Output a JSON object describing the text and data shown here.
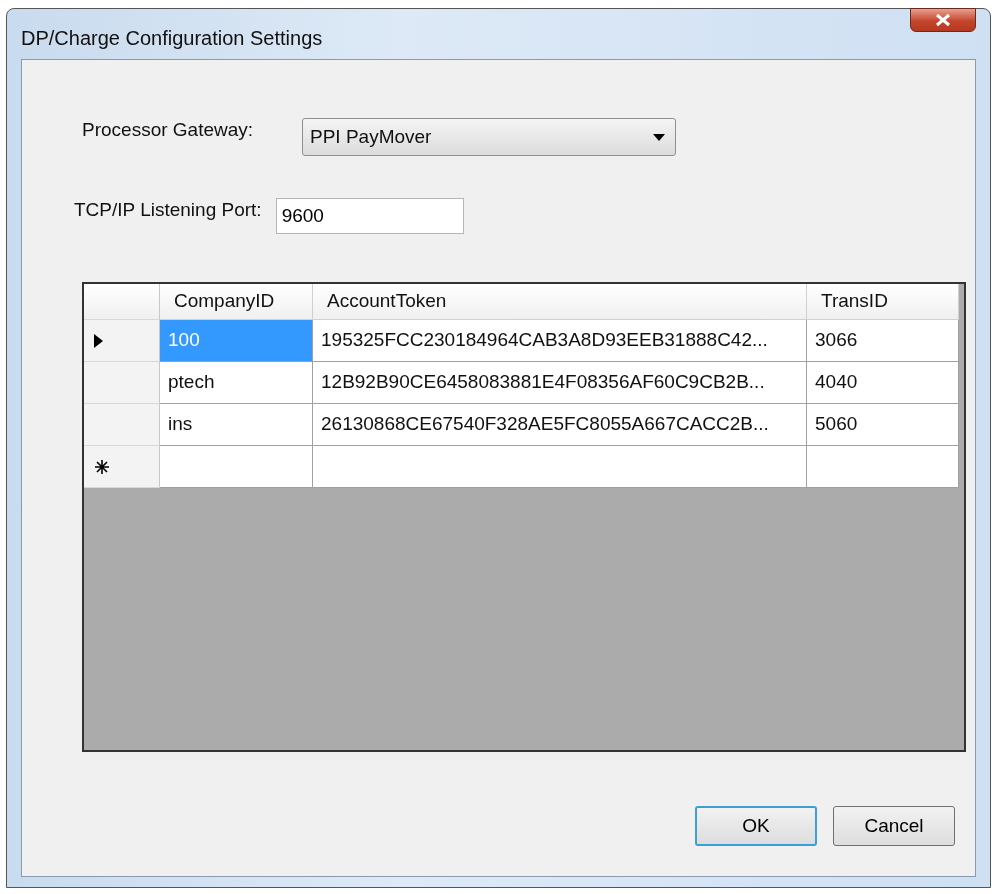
{
  "window": {
    "title": "DP/Charge Configuration Settings"
  },
  "processor_gateway": {
    "label": "Processor Gateway:",
    "value": "PPI PayMover"
  },
  "listening_port": {
    "label": "TCP/IP Listening Port:",
    "value": "9600"
  },
  "table": {
    "columns": [
      "CompanyID",
      "AccountToken",
      "TransID"
    ],
    "rows": [
      {
        "current": true,
        "cells": [
          {
            "text": "100",
            "selected": true
          },
          {
            "text": "195325FCC230184964CAB3A8D93EEB31888C42...",
            "selected": false
          },
          {
            "text": "3066",
            "selected": false
          }
        ]
      },
      {
        "current": false,
        "cells": [
          {
            "text": "ptech",
            "selected": false
          },
          {
            "text": "12B92B90CE6458083881E4F08356AF60C9CB2B...",
            "selected": false
          },
          {
            "text": "4040",
            "selected": false
          }
        ]
      },
      {
        "current": false,
        "cells": [
          {
            "text": "ins",
            "selected": false
          },
          {
            "text": "26130868CE67540F328AE5FC8055A667CACC2B...",
            "selected": false
          },
          {
            "text": "5060",
            "selected": false
          }
        ]
      }
    ],
    "new_row": true
  },
  "buttons": [
    {
      "label": "OK",
      "default": true
    },
    {
      "label": "Cancel",
      "default": false
    }
  ]
}
